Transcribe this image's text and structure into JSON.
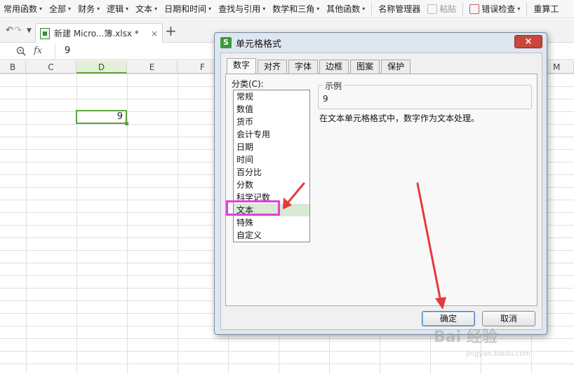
{
  "ribbon": {
    "items": [
      {
        "label": "常用函数",
        "dd": "▾"
      },
      {
        "label": "全部",
        "dd": "▾"
      },
      {
        "label": "财务",
        "dd": "▾"
      },
      {
        "label": "逻辑",
        "dd": "▾"
      },
      {
        "label": "文本",
        "dd": "▾"
      },
      {
        "label": "日期和时间",
        "dd": "▾"
      },
      {
        "label": "查找与引用",
        "dd": "▾"
      },
      {
        "label": "数学和三角",
        "dd": "▾"
      },
      {
        "label": "其他函数",
        "dd": "▾"
      },
      {
        "label": "名称管理器",
        "dd": ""
      },
      {
        "label": "粘贴",
        "dd": ""
      },
      {
        "label": "错误检查",
        "dd": "▾"
      },
      {
        "label": "重算工",
        "dd": ""
      }
    ]
  },
  "tabbar": {
    "doc_name": "新建 Micro...簿.xlsx *",
    "close": "×",
    "plus": "+"
  },
  "formula_bar": {
    "fx": "fx",
    "value": "9"
  },
  "sheet": {
    "columns": [
      "B",
      "C",
      "D",
      "E",
      "F",
      "M"
    ],
    "selected_column": "D",
    "cell_value": "9"
  },
  "dialog": {
    "title": "单元格格式",
    "close": "×",
    "tabs": [
      "数字",
      "对齐",
      "字体",
      "边框",
      "图案",
      "保护"
    ],
    "active_tab": "数字",
    "category_label": "分类(C):",
    "categories": [
      "常规",
      "数值",
      "货币",
      "会计专用",
      "日期",
      "时间",
      "百分比",
      "分数",
      "科学记数",
      "文本",
      "特殊",
      "自定义"
    ],
    "selected_category": "文本",
    "sample_legend": "示例",
    "sample_value": "9",
    "description": "在文本单元格格式中，数字作为文本处理。",
    "ok_label": "确定",
    "cancel_label": "取消"
  },
  "watermark": {
    "text": "Bai 经验",
    "sub": "jingyan.baidu.com"
  },
  "colors": {
    "accent_green": "#5aa73a",
    "highlight_magenta": "#e33fe0",
    "arrow_red": "#e53a3a",
    "close_red": "#c9463d"
  }
}
